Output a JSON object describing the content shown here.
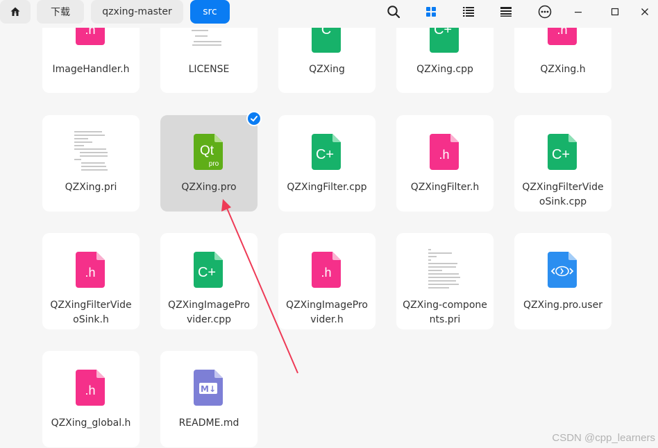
{
  "breadcrumbs": [
    {
      "label": "下载"
    },
    {
      "label": "qzxing-master"
    },
    {
      "label": "src",
      "active": true
    }
  ],
  "toolbar": {
    "icons": [
      "search-icon",
      "grid-view-icon",
      "list-view-icon",
      "detail-view-icon",
      "more-icon",
      "minimize-icon",
      "maximize-icon",
      "close-icon"
    ],
    "active_view": "grid-view-icon",
    "accent_color": "#0a7cf3"
  },
  "files": [
    {
      "name": "ImageHandler.h",
      "type": "h"
    },
    {
      "name": "LICENSE",
      "type": "text-preview"
    },
    {
      "name": "QZXing",
      "type": "c"
    },
    {
      "name": "QZXing.cpp",
      "type": "cpp"
    },
    {
      "name": "QZXing.h",
      "type": "h"
    },
    {
      "name": "QZXing.pri",
      "type": "text-preview"
    },
    {
      "name": "QZXing.pro",
      "type": "qtpro",
      "selected": true
    },
    {
      "name": "QZXingFilter.cpp",
      "type": "cpp"
    },
    {
      "name": "QZXingFilter.h",
      "type": "h"
    },
    {
      "name": "QZXingFilterVideoSink.cpp",
      "type": "cpp"
    },
    {
      "name": "QZXingFilterVideoSink.h",
      "type": "h"
    },
    {
      "name": "QZXingImageProvider.cpp",
      "type": "cpp"
    },
    {
      "name": "QZXingImageProvider.h",
      "type": "h"
    },
    {
      "name": "QZXing-components.pri",
      "type": "text-preview"
    },
    {
      "name": "QZXing.pro.user",
      "type": "xml"
    },
    {
      "name": "QZXing_global.h",
      "type": "h"
    },
    {
      "name": "README.md",
      "type": "md"
    }
  ],
  "names_wrapped": {
    "filterSinkCpp": [
      "QZXingFilterVide",
      "oSink.cpp"
    ],
    "filterSinkH": [
      "QZXingFilterVide",
      "oSink.h"
    ],
    "imgProvCpp": [
      "QZXingImagePro",
      "vider.cpp"
    ],
    "imgProvH": [
      "QZXingImagePro",
      "vider.h"
    ],
    "components": [
      "QZXing-compone",
      "nts.pri"
    ]
  },
  "icon_glyphs": {
    "h": ".h",
    "c": "C",
    "cpp": "C+",
    "qt": "Qt",
    "qt_sub": "pro",
    "md": "M↓"
  },
  "colors": {
    "h": "#f5308a",
    "cpp": "#17b26a",
    "qt": "#5fae18",
    "xml": "#2b8ef0",
    "md": "#7d7fd6",
    "arrow": "#ee3a56"
  },
  "annotation": "arrow pointing to QZXing.pro",
  "watermark": "CSDN @cpp_learners"
}
